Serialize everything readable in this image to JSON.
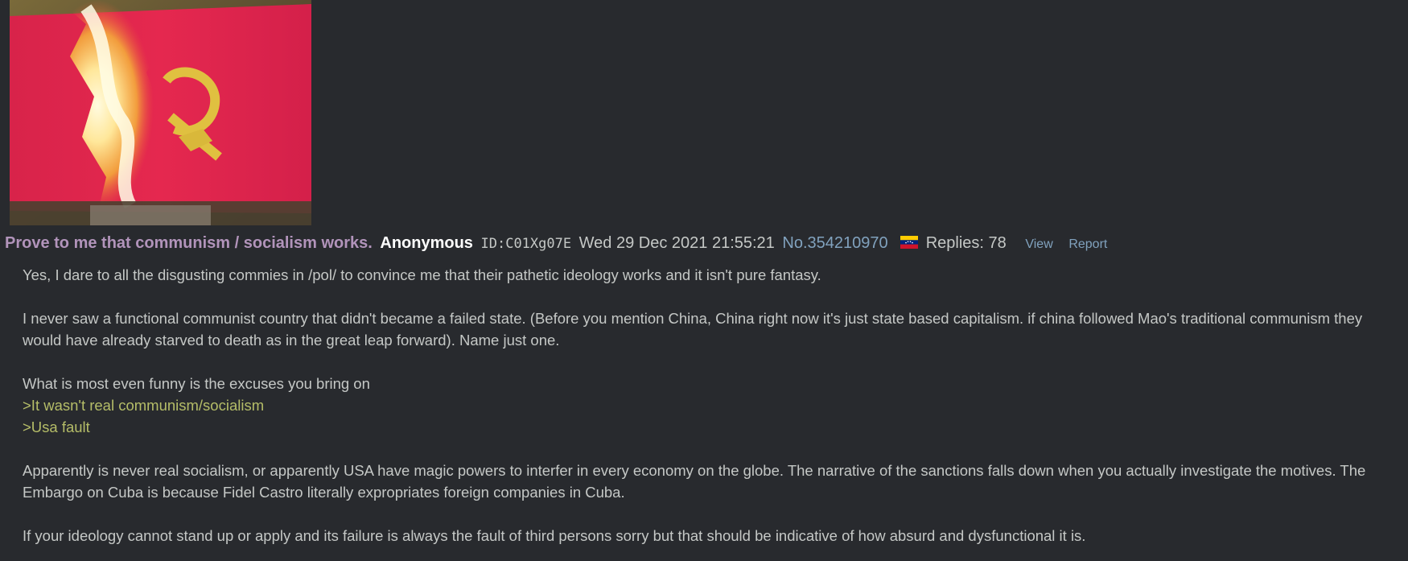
{
  "post": {
    "image_alt": "Burning red communist flag with hammer and sickle",
    "subject": "Prove to me that communism / socialism works.",
    "name": "Anonymous",
    "poster_id": "ID:C01Xg07E",
    "date": "Wed 29 Dec 2021 21:55:21",
    "number": "No.354210970",
    "flag_icon": "venezuela-flag-icon",
    "replies": "Replies: 78",
    "view_label": "View",
    "report_label": "Report"
  },
  "body": {
    "line1": "Yes, I dare to all the disgusting commies in /pol/ to convince me that their pathetic ideology works and it isn't pure fantasy.",
    "line2": "I never saw a functional communist country that didn't became a failed state. (Before you mention China, China right now it's just state based capitalism. if china followed Mao's traditional communism they would have already starved to death as in the great leap forward). Name just one.",
    "line3": "What is most even funny is the excuses you bring on",
    "quote1": ">It wasn't real communism/socialism",
    "quote2": ">Usa fault",
    "line4": "Apparently is never real socialism, or apparently USA have magic powers to interfer in every economy on the globe. The narrative of the sanctions falls down when you actually investigate the motives. The Embargo on Cuba is because Fidel Castro literally expropriates foreign companies in Cuba.",
    "line5": "If your ideology cannot stand up or apply and its failure is always the fault of third persons sorry but that should be indicative of how absurd and dysfunctional it is."
  },
  "colors": {
    "background": "#282a2e",
    "subject": "#b294bb",
    "link": "#81a2be",
    "greentext": "#b5bd68",
    "text": "#c5c8c6"
  }
}
